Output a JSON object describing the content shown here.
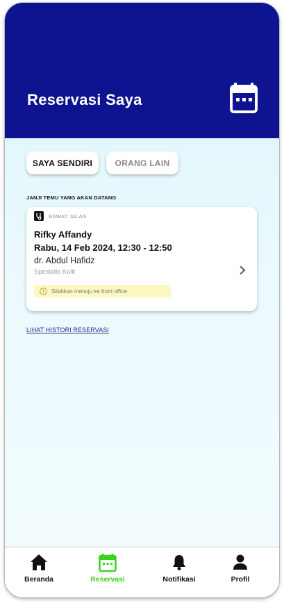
{
  "header": {
    "title": "Reservasi Saya",
    "icon": "calendar-icon"
  },
  "segments": {
    "self_label": "SAYA SENDIRI",
    "other_label": "ORANG LAIN",
    "active": "self"
  },
  "section_label": "JANJI TEMU YANG AKAN DATANG",
  "appointment": {
    "type_icon": "stethoscope-icon",
    "type_label": "RAWAT JALAN",
    "patient": "Rifky Affandy",
    "datetime": "Rabu, 14 Feb 2024, 12:30 - 12:50",
    "doctor": "dr. Abdul Hafidz",
    "specialty": "Spesialis Kulit",
    "notice": "Silahkan menuju ke front office",
    "notice_icon": "info-icon"
  },
  "history_link": "LIHAT HISTORI RESERVASI",
  "nav": {
    "items": [
      {
        "label": "Beranda",
        "icon": "home-icon"
      },
      {
        "label": "Reservasi",
        "icon": "calendar-icon"
      },
      {
        "label": "Notifikasi",
        "icon": "bell-icon"
      },
      {
        "label": "Profil",
        "icon": "user-icon"
      }
    ],
    "active_index": 1
  },
  "colors": {
    "header_bg": "#0e1490",
    "active_nav": "#36d41c",
    "notice_bg": "#fdf8c0"
  }
}
